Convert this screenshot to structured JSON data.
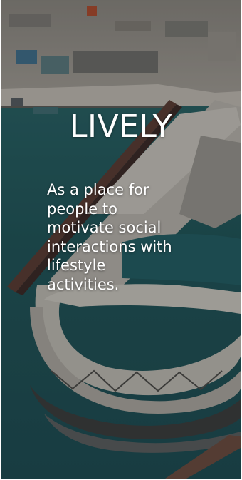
{
  "card": {
    "title": "LIVELY",
    "description": "As a place for\npeople to\nmotivate social\ninteractions with\nlifestyle\nactivities."
  },
  "colors": {
    "water": "#1e5a5e",
    "deck": "#b8b4ac",
    "text": "#ffffff"
  }
}
